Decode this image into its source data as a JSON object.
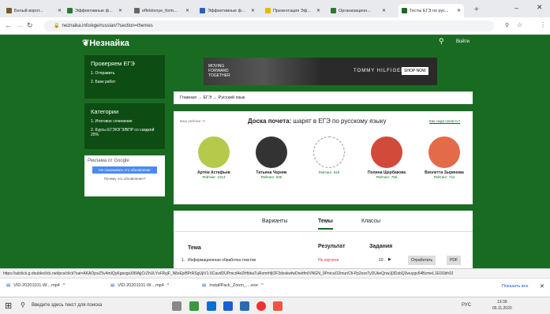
{
  "tabs": [
    {
      "label": "Белый ворот... ",
      "active": false,
      "color": "#7a5a2a"
    },
    {
      "label": "Эффективные ф...",
      "active": false,
      "color": "#2a7a2a"
    },
    {
      "label": "effektivnye_form...",
      "active": false,
      "color": "#666"
    },
    {
      "label": "Эффективные ф...",
      "active": false,
      "color": "#2b5fb5"
    },
    {
      "label": "Презентация Эф...",
      "active": false,
      "color": "#e5b800"
    },
    {
      "label": "Организацион...",
      "active": false,
      "color": "#2a7a2a"
    },
    {
      "label": "Тесты ЕГЭ по рус...",
      "active": true,
      "color": "#1a6b22"
    }
  ],
  "address": {
    "url": "neznaika.info/ege/russian/?section=themes"
  },
  "site": {
    "logo": "Незнайка",
    "login": "Войти",
    "breadcrumb": "Главная → ЕГЭ → Русский язык",
    "sidebar": {
      "box1_title": "Проверяем ЕГЭ",
      "box1_items": [
        "1. Отправить",
        "2. Банк работ"
      ],
      "box2_title": "Категории",
      "box2_items": [
        "1. Итоговое сочинение",
        "2. Курсы ЕГЭ/ОГЭ/ВПР со скидкой 25%"
      ],
      "ad_label": "Реклама от Google",
      "ad_button": "Не показывать это объявление",
      "ad_why": "Почему это объявление?"
    },
    "banner": {
      "brand": "TOMMY HILFIGER",
      "cta": "SHOP NOW",
      "moving": "MOVING FORWARD TOGETHER"
    },
    "honor": {
      "your_rating": "Ваш рейтинг: 0",
      "title_bold": "Доска почета:",
      "title_rest": " шарят в ЕГЭ по русскому языку",
      "link": "Как сюда попасть?",
      "people": [
        {
          "name": "Артём Астафьев",
          "rating": "Рейтинг: 1013",
          "bg": "#b7c94a"
        },
        {
          "name": "Татьяна Черняк",
          "rating": "Рейтинг: 945",
          "bg": "#333"
        },
        {
          "name": "",
          "rating": "Рейтинг: 919",
          "bg": "#fff"
        },
        {
          "name": "Полина Щербакова",
          "rating": "Рейтинг: 756",
          "bg": "#d14a3a"
        },
        {
          "name": "Виолетта Зырянова",
          "rating": "Рейтинг: 744",
          "bg": "#e36b4a"
        }
      ]
    },
    "tabs": [
      "Варианты",
      "Темы",
      "Классы"
    ],
    "table": {
      "head": [
        "Тема",
        "Результат",
        "Задания"
      ],
      "row": {
        "n": "1.",
        "topic": "Информационная обработка текстов",
        "result": "Не изучена",
        "count": "10",
        "btn1": "Отработать",
        "btn2": "PDF"
      }
    }
  },
  "status": "https://adclick.g.doubleclick.net/pcs/click?xai=AKAOjsvZ5v4mIQyKgezgsX89AjjCrZhULYsFRyjF_N8zEjxBPrRSgUjiV1-5CavdDUPmcd4eZtHbkaTuRomrhfjOF3dvskwfwDnetfmIVNGN_0PnrcuO2munCfi-Pp2oxxTyDUkeQnwJj3DxbQ2wuygv54BzmeL1E0l1bh9J",
  "downloads": [
    {
      "name": "VID-20201101-W....mp4"
    },
    {
      "name": "VID-20201101-W....mp4"
    },
    {
      "name": "InstallPack_Zoom_....exe"
    }
  ],
  "show_all": "Показать все",
  "taskbar": {
    "search": "Введите здесь текст для поиска",
    "lang": "РУС",
    "time": "13:39",
    "date": "05.11.2020"
  }
}
